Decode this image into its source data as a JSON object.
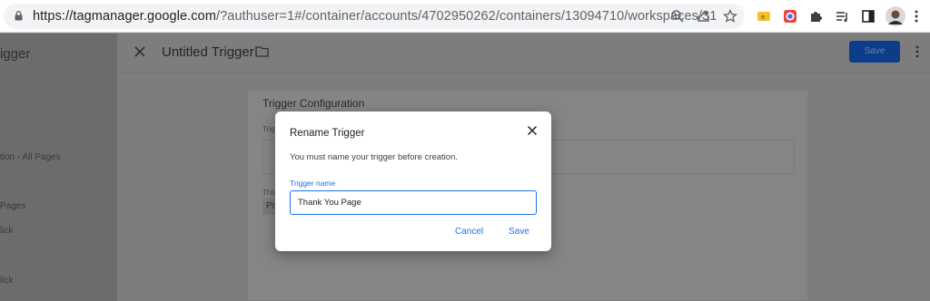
{
  "browser": {
    "url_host": "https://tagmanager.google.com",
    "url_path": "/?authuser=1#/container/accounts/4702950262/containers/13094710/workspaces/31",
    "icons": [
      "lock-icon",
      "zoom-icon",
      "share-icon",
      "bookmark-star-icon",
      "extension-icon-1",
      "extension-icon-2",
      "extensions-puzzle-icon",
      "media-queue-icon",
      "side-panel-icon",
      "profile-avatar"
    ]
  },
  "sidebar": {
    "title_fragment": "igger",
    "items": [
      "tion - All Pages",
      "Pages",
      "lick",
      "lick"
    ]
  },
  "trigger_panel": {
    "title": "Untitled Trigger",
    "save_label": "Save",
    "card_title": "Trigger Configuration",
    "card_field_fragment": "Trig",
    "card_small_fragment": "This",
    "card_select_fragment": "Pr"
  },
  "dialog": {
    "title": "Rename Trigger",
    "message": "You must name your trigger before creation.",
    "field_label": "Trigger name",
    "field_value": "Thank You Page",
    "cancel_label": "Cancel",
    "save_label": "Save"
  },
  "colors": {
    "accent": "#1a73e8",
    "save_dim": "#0d3d8a",
    "overlay": "#7d7d7d"
  }
}
